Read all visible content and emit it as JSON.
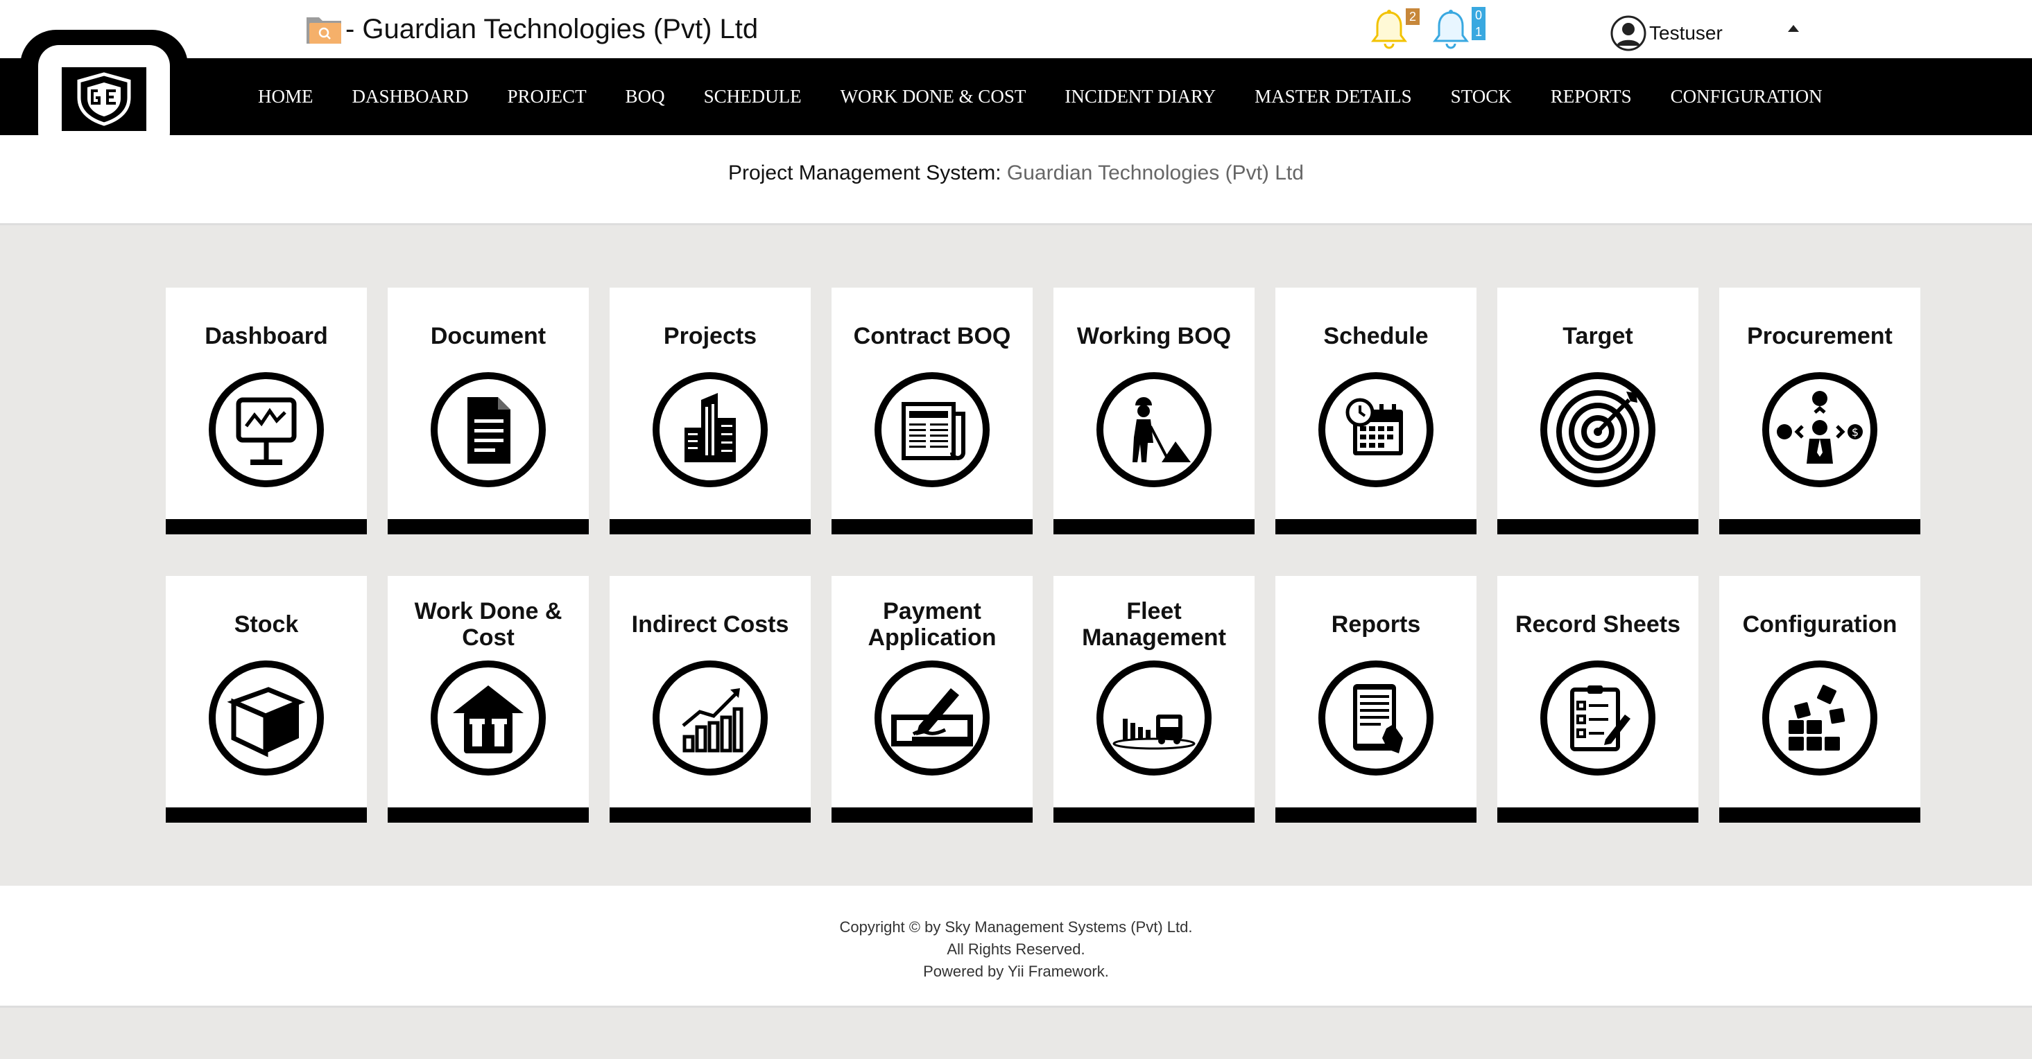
{
  "header": {
    "title": "- Guardian Technologies (Pvt) Ltd",
    "notifications": [
      {
        "icon": "bell-icon",
        "color": "#f2c200",
        "badge": "2",
        "badge_color": "#c7873a"
      },
      {
        "icon": "bell-icon",
        "color": "#39a8e0",
        "badge_top": "0",
        "badge_bottom": "1",
        "badge_color": "#39a8e0"
      }
    ],
    "user": {
      "name": "Testuser"
    }
  },
  "nav": {
    "items": [
      "HOME",
      "DASHBOARD",
      "PROJECT",
      "BOQ",
      "SCHEDULE",
      "WORK DONE & COST",
      "INCIDENT DIARY",
      "MASTER DETAILS",
      "STOCK",
      "REPORTS",
      "CONFIGURATION"
    ]
  },
  "subtitle": {
    "label": "Project Management System:",
    "value": "Guardian Technologies (Pvt) Ltd"
  },
  "tiles": [
    {
      "label": "Dashboard",
      "icon": "dashboard-monitor-icon"
    },
    {
      "label": "Document",
      "icon": "document-icon"
    },
    {
      "label": "Projects",
      "icon": "building-icon"
    },
    {
      "label": "Contract BOQ",
      "icon": "newspaper-icon"
    },
    {
      "label": "Working BOQ",
      "icon": "construction-worker-icon"
    },
    {
      "label": "Schedule",
      "icon": "calendar-clock-icon"
    },
    {
      "label": "Target",
      "icon": "target-icon"
    },
    {
      "label": "Procurement",
      "icon": "procurement-icon"
    },
    {
      "label": "Stock",
      "icon": "box-icon"
    },
    {
      "label": "Work Done & Cost",
      "icon": "toolbox-icon"
    },
    {
      "label": "Indirect Costs",
      "icon": "growth-chart-icon"
    },
    {
      "label": "Payment Application",
      "icon": "cheque-pen-icon"
    },
    {
      "label": "Fleet Management",
      "icon": "fleet-truck-icon"
    },
    {
      "label": "Reports",
      "icon": "tablet-report-icon"
    },
    {
      "label": "Record Sheets",
      "icon": "checklist-icon"
    },
    {
      "label": "Configuration",
      "icon": "blocks-icon"
    }
  ],
  "footer": {
    "line1": "Copyright © by Sky Management Systems (Pvt) Ltd.",
    "line2": "All Rights Reserved.",
    "line3_prefix": "Powered by ",
    "line3_link": "Yii Framework",
    "line3_suffix": "."
  }
}
